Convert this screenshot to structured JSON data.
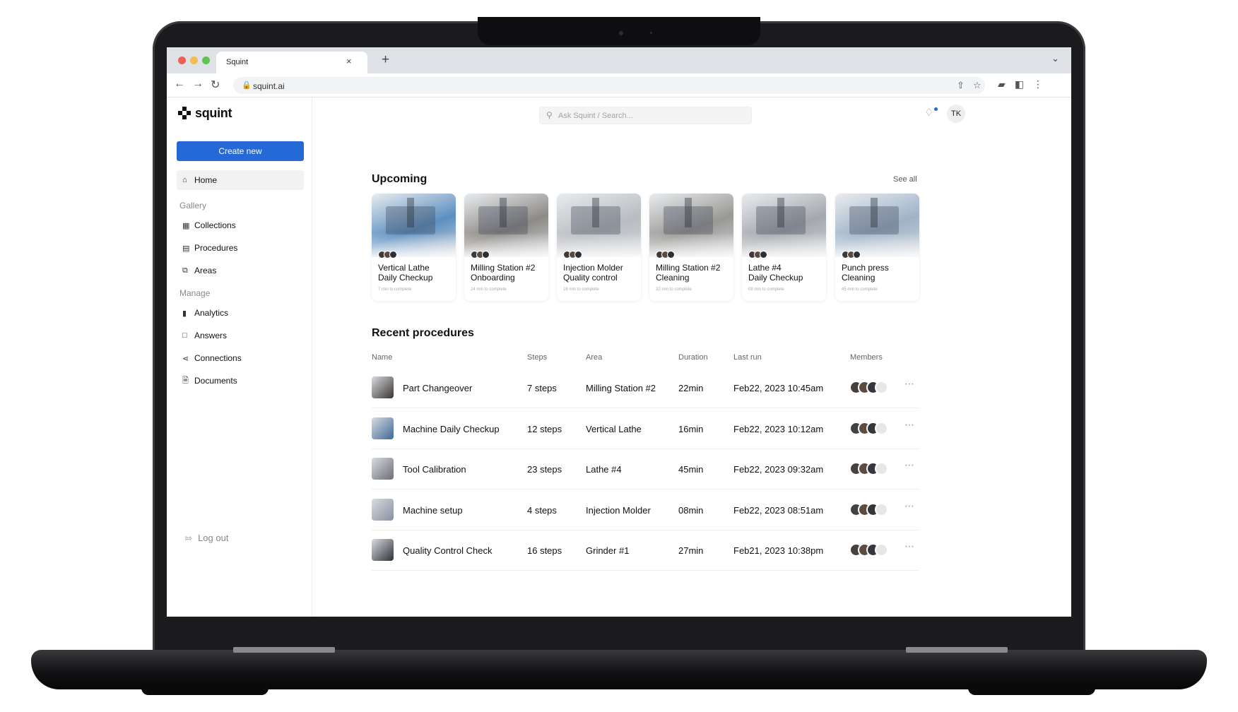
{
  "browser": {
    "tab_title": "Squint",
    "tab_close": "×",
    "new_tab": "+",
    "url": "squint.ai"
  },
  "sidebar": {
    "logo": "squint",
    "create_button": "Create new",
    "home": "Home",
    "gallery_label": "Gallery",
    "gallery_items": [
      {
        "label": "Collections",
        "icon": "grid-icon"
      },
      {
        "label": "Procedures",
        "icon": "clipboard-icon"
      },
      {
        "label": "Areas",
        "icon": "layers-icon"
      }
    ],
    "manage_label": "Manage",
    "manage_items": [
      {
        "label": "Analytics",
        "icon": "bar-chart-icon"
      },
      {
        "label": "Answers",
        "icon": "chat-icon"
      },
      {
        "label": "Connections",
        "icon": "share-icon"
      },
      {
        "label": "Documents",
        "icon": "document-icon"
      }
    ],
    "logout": "Log out"
  },
  "header": {
    "search_placeholder": "Ask Squint / Search...",
    "user_initials": "TK"
  },
  "upcoming": {
    "title": "Upcoming",
    "see_all": "See all",
    "cards": [
      {
        "title_line1": "Vertical Lathe",
        "title_line2": "Daily Checkup",
        "subtitle": "7 min to complete",
        "tint": "#5b8fc1"
      },
      {
        "title_line1": "Milling Station #2",
        "title_line2": "Onboarding",
        "subtitle": "24 min to complete",
        "tint": "#8d8a86"
      },
      {
        "title_line1": "Injection Molder",
        "title_line2": "Quality control",
        "subtitle": "16 min to complete",
        "tint": "#b9bcc0"
      },
      {
        "title_line1": "Milling Station #2",
        "title_line2": "Cleaning",
        "subtitle": "32 min to complete",
        "tint": "#9a9894"
      },
      {
        "title_line1": "Lathe #4",
        "title_line2": "Daily Checkup",
        "subtitle": "08 min to complete",
        "tint": "#a4a8ad"
      },
      {
        "title_line1": "Punch press",
        "title_line2": "Cleaning",
        "subtitle": "45 min to complete",
        "tint": "#9fb3c8"
      }
    ]
  },
  "recent": {
    "title": "Recent procedures",
    "columns": {
      "name": "Name",
      "steps": "Steps",
      "area": "Area",
      "duration": "Duration",
      "last_run": "Last run",
      "members": "Members"
    },
    "rows": [
      {
        "name": "Part Changeover",
        "steps": "7 steps",
        "area": "Milling Station #2",
        "duration": "22min",
        "last_run": "Feb22, 2023 10:45am",
        "thumb": "#3b3431"
      },
      {
        "name": "Machine Daily Checkup",
        "steps": "12 steps",
        "area": "Vertical Lathe",
        "duration": "16min",
        "last_run": "Feb22, 2023 10:12am",
        "thumb": "#3e6a96"
      },
      {
        "name": "Tool Calibration",
        "steps": "23 steps",
        "area": "Lathe #4",
        "duration": "45min",
        "last_run": "Feb22, 2023 09:32am",
        "thumb": "#6b6e73"
      },
      {
        "name": "Machine setup",
        "steps": "4 steps",
        "area": "Injection Molder",
        "duration": "08min",
        "last_run": "Feb22, 2023 08:51am",
        "thumb": "#8791a0"
      },
      {
        "name": "Quality Control Check",
        "steps": "16 steps",
        "area": "Grinder #1",
        "duration": "27min",
        "last_run": "Feb21, 2023 10:38pm",
        "thumb": "#2e3238"
      }
    ]
  },
  "colors": {
    "accent": "#2469d6"
  }
}
